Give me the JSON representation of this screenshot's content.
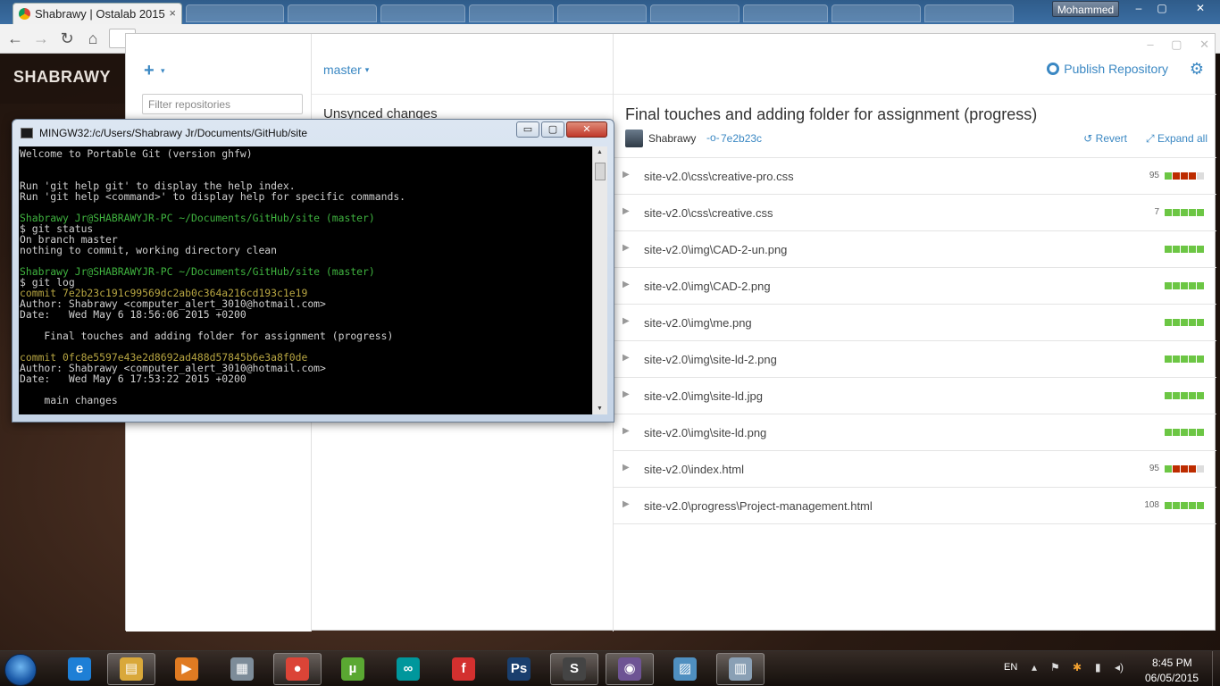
{
  "browser": {
    "active_tab_title": "Shabrawy | Ostalab 2015",
    "tab_close": "×",
    "user_label": "Mohammed",
    "window_controls": [
      "–",
      "▢",
      "✕"
    ]
  },
  "website": {
    "brand": "SHABRAWY"
  },
  "github_desktop": {
    "add_label": "+",
    "add_caret": "▾",
    "filter_placeholder": "Filter repositories",
    "branch": "master",
    "branch_caret": "▾",
    "unsynced": "Unsynced changes",
    "publish_label": "Publish Repository",
    "settings_glyph": "⚙",
    "window_controls": [
      "–",
      "▢",
      "✕"
    ],
    "commit": {
      "title": "Final touches and adding folder for assignment (progress)",
      "author": "Shabrawy",
      "sha_icon": "-o-",
      "sha": "7e2b23c",
      "revert_label": "↺ Revert",
      "expand_label": "⤢ Expand all"
    },
    "files": [
      {
        "path": "site-v2.0\\css\\creative-pro.css",
        "count": "95",
        "bars": [
          "g",
          "r",
          "r",
          "r",
          "n"
        ]
      },
      {
        "path": "site-v2.0\\css\\creative.css",
        "count": "7",
        "bars": [
          "g",
          "g",
          "g",
          "g",
          "g"
        ]
      },
      {
        "path": "site-v2.0\\img\\CAD-2-un.png",
        "count": "",
        "bars": [
          "g",
          "g",
          "g",
          "g",
          "g"
        ]
      },
      {
        "path": "site-v2.0\\img\\CAD-2.png",
        "count": "",
        "bars": [
          "g",
          "g",
          "g",
          "g",
          "g"
        ]
      },
      {
        "path": "site-v2.0\\img\\me.png",
        "count": "",
        "bars": [
          "g",
          "g",
          "g",
          "g",
          "g"
        ]
      },
      {
        "path": "site-v2.0\\img\\site-ld-2.png",
        "count": "",
        "bars": [
          "g",
          "g",
          "g",
          "g",
          "g"
        ]
      },
      {
        "path": "site-v2.0\\img\\site-ld.jpg",
        "count": "",
        "bars": [
          "g",
          "g",
          "g",
          "g",
          "g"
        ]
      },
      {
        "path": "site-v2.0\\img\\site-ld.png",
        "count": "",
        "bars": [
          "g",
          "g",
          "g",
          "g",
          "g"
        ]
      },
      {
        "path": "site-v2.0\\index.html",
        "count": "95",
        "bars": [
          "g",
          "r",
          "r",
          "r",
          "n"
        ]
      },
      {
        "path": "site-v2.0\\progress\\Project-management.html",
        "count": "108",
        "bars": [
          "g",
          "g",
          "g",
          "g",
          "g"
        ]
      }
    ],
    "diff_colors": {
      "g": "#6cc644",
      "r": "#bd2c00",
      "n": "#dddddd"
    }
  },
  "terminal": {
    "title": "MINGW32:/c/Users/Shabrawy Jr/Documents/GitHub/site",
    "controls": [
      "▭",
      "▢",
      "✕"
    ],
    "scroll_up": "▲",
    "scroll_down": "▼",
    "lines": [
      {
        "text": "Welcome to Portable Git (version ghfw)",
        "color": ""
      },
      {
        "text": "",
        "color": ""
      },
      {
        "text": "",
        "color": ""
      },
      {
        "text": "Run 'git help git' to display the help index.",
        "color": ""
      },
      {
        "text": "Run 'git help <command>' to display help for specific commands.",
        "color": ""
      },
      {
        "text": "",
        "color": ""
      },
      {
        "text": "Shabrawy Jr@SHABRAWYJR-PC ~/Documents/GitHub/site (master)",
        "color": "green"
      },
      {
        "text": "$ git status",
        "color": ""
      },
      {
        "text": "On branch master",
        "color": ""
      },
      {
        "text": "nothing to commit, working directory clean",
        "color": ""
      },
      {
        "text": "",
        "color": ""
      },
      {
        "text": "Shabrawy Jr@SHABRAWYJR-PC ~/Documents/GitHub/site (master)",
        "color": "green"
      },
      {
        "text": "$ git log",
        "color": ""
      },
      {
        "text": "commit 7e2b23c191c99569dc2ab0c364a216cd193c1e19",
        "color": "yellow"
      },
      {
        "text": "Author: Shabrawy <computer_alert_3010@hotmail.com>",
        "color": ""
      },
      {
        "text": "Date:   Wed May 6 18:56:06 2015 +0200",
        "color": ""
      },
      {
        "text": "",
        "color": ""
      },
      {
        "text": "    Final touches and adding folder for assignment (progress)",
        "color": ""
      },
      {
        "text": "",
        "color": ""
      },
      {
        "text": "commit 0fc8e5597e43e2d8692ad488d57845b6e3a8f0de",
        "color": "yellow"
      },
      {
        "text": "Author: Shabrawy <computer_alert_3010@hotmail.com>",
        "color": ""
      },
      {
        "text": "Date:   Wed May 6 17:53:22 2015 +0200",
        "color": ""
      },
      {
        "text": "",
        "color": ""
      },
      {
        "text": "    main changes",
        "color": ""
      }
    ]
  },
  "taskbar": {
    "apps": [
      {
        "name": "internet-explorer",
        "glyph": "e",
        "color": "#1e7fd6"
      },
      {
        "name": "file-explorer",
        "glyph": "▤",
        "color": "#d9a83a"
      },
      {
        "name": "media-player",
        "glyph": "▶",
        "color": "#e07b22"
      },
      {
        "name": "calculator",
        "glyph": "▦",
        "color": "#7d8c99"
      },
      {
        "name": "chrome",
        "glyph": "●",
        "color": "#db4437"
      },
      {
        "name": "utorrent",
        "glyph": "µ",
        "color": "#5aa832"
      },
      {
        "name": "arduino",
        "glyph": "∞",
        "color": "#00979c"
      },
      {
        "name": "foxit",
        "glyph": "f",
        "color": "#d3302f"
      },
      {
        "name": "photoshop",
        "glyph": "Ps",
        "color": "#1a3f6e"
      },
      {
        "name": "sublime-text",
        "glyph": "S",
        "color": "#444444"
      },
      {
        "name": "github-desktop",
        "glyph": "◉",
        "color": "#6e5494"
      },
      {
        "name": "photo-viewer",
        "glyph": "▨",
        "color": "#4f8fc0"
      },
      {
        "name": "document-viewer",
        "glyph": "▥",
        "color": "#8aa0b5"
      }
    ],
    "language": "EN",
    "tray_icons": [
      "▴",
      "⚑",
      "✱",
      "▮",
      "◂)"
    ],
    "time": "8:45 PM",
    "date": "06/05/2015"
  }
}
